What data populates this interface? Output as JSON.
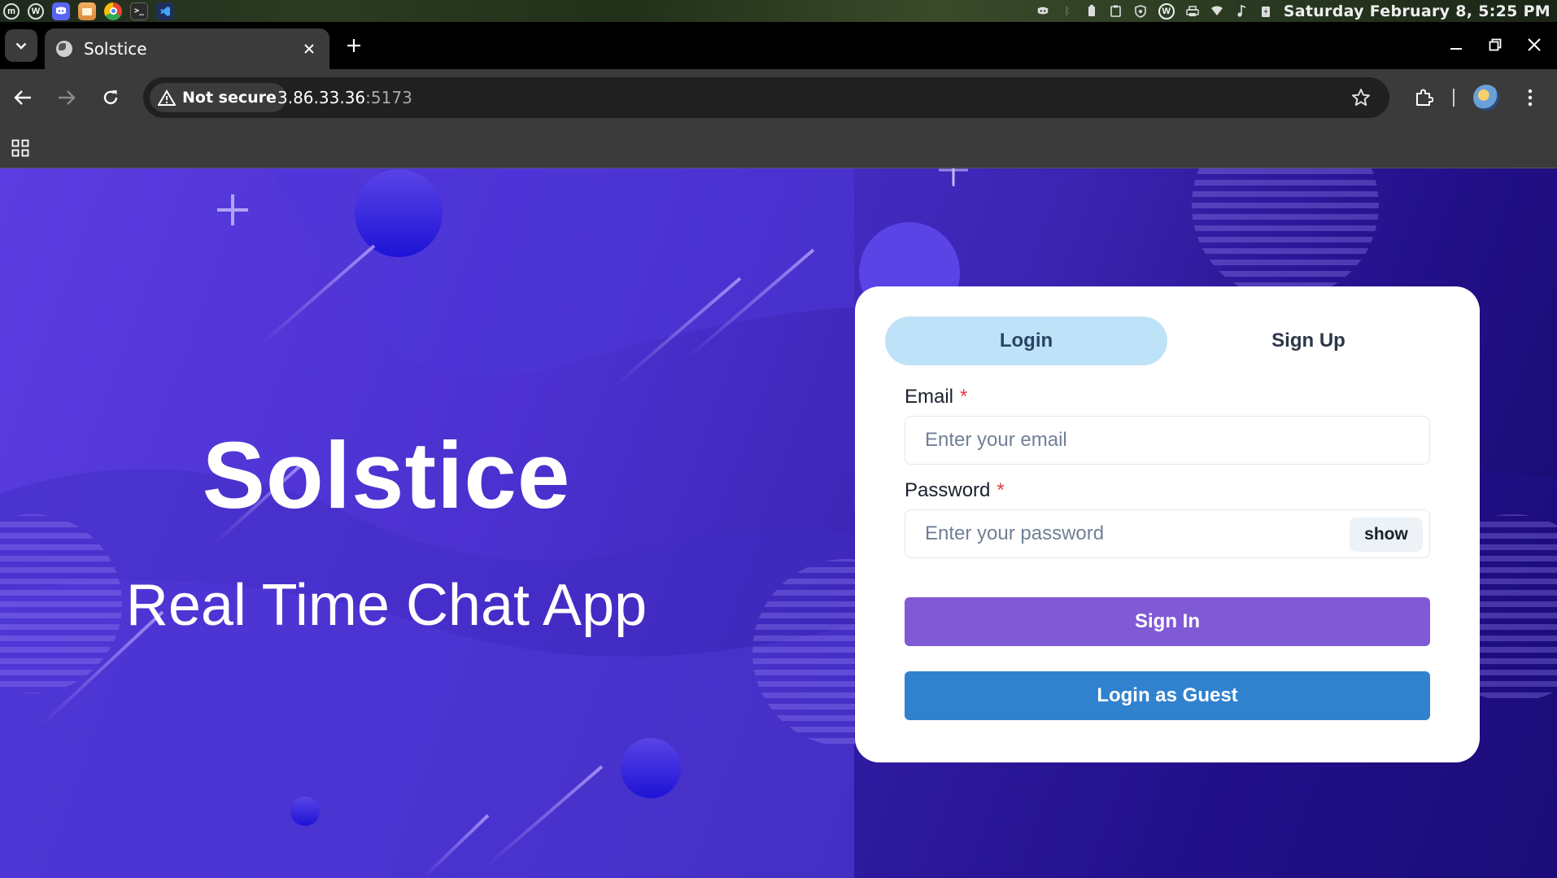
{
  "os": {
    "clock": "Saturday February  8,  5:25 PM",
    "launcher_icons": [
      "mint-menu-icon",
      "w-app-icon",
      "discord-icon",
      "files-icon",
      "chrome-icon",
      "terminal-icon",
      "vscode-icon"
    ],
    "tray_icons": [
      "discord-tray-icon",
      "bluetooth-icon",
      "battery-icon",
      "clipboard-icon",
      "shield-icon",
      "w-tray-icon",
      "printer-icon",
      "wifi-icon",
      "volume-icon",
      "power-icon"
    ]
  },
  "browser": {
    "tab_title": "Solstice",
    "address_host": "3.86.33.36",
    "address_port": ":5173",
    "security_label": "Not secure"
  },
  "hero": {
    "title": "Solstice",
    "subtitle": "Real Time Chat App"
  },
  "auth": {
    "tabs": [
      "Login",
      "Sign Up"
    ],
    "active_tab": "Login",
    "email_label": "Email",
    "email_placeholder": "Enter your email",
    "password_label": "Password",
    "password_placeholder": "Enter your password",
    "required_mark": "*",
    "show_label": "show",
    "sign_in_label": "Sign In",
    "guest_label": "Login as Guest"
  },
  "colors": {
    "bg_primary": "#5a3ce0",
    "bg_dark": "#160a6a",
    "tab_active": "#bee3f8",
    "sign_in": "#805ad5",
    "guest": "#3182ce",
    "required": "#e53e3e"
  }
}
